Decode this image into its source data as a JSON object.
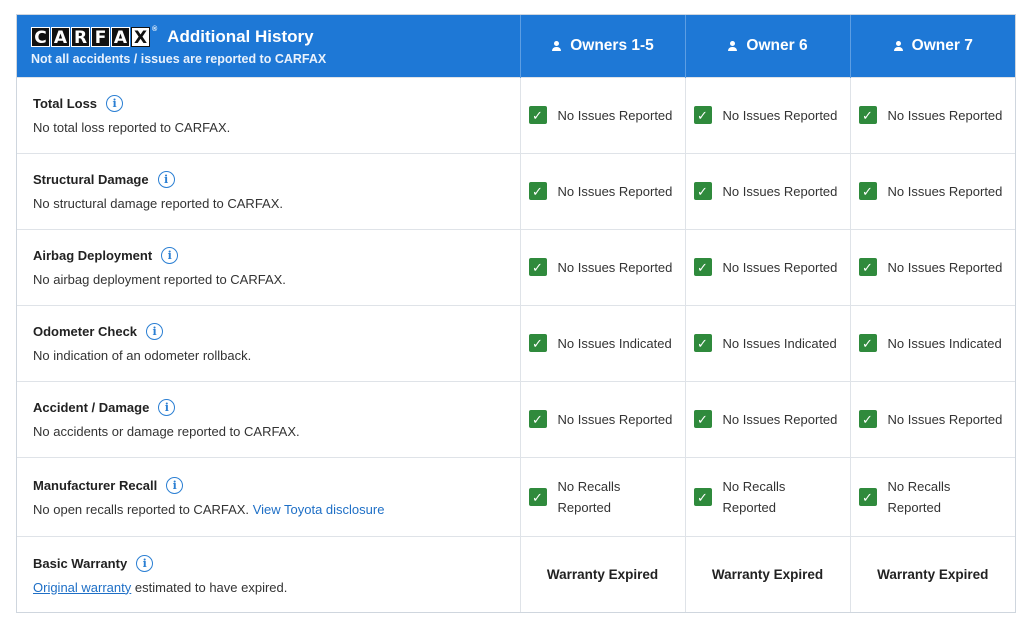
{
  "header": {
    "logo_letters": [
      "C",
      "A",
      "R",
      "F",
      "A",
      "X"
    ],
    "title": "Additional History",
    "subtitle": "Not all accidents / issues are reported to CARFAX",
    "owners": [
      "Owners 1-5",
      "Owner 6",
      "Owner 7"
    ]
  },
  "rows": [
    {
      "title": "Total Loss",
      "desc": "No total loss reported to CARFAX.",
      "status": [
        "No Issues Reported",
        "No Issues Reported",
        "No Issues Reported"
      ]
    },
    {
      "title": "Structural Damage",
      "desc": "No structural damage reported to CARFAX.",
      "status": [
        "No Issues Reported",
        "No Issues Reported",
        "No Issues Reported"
      ]
    },
    {
      "title": "Airbag Deployment",
      "desc": "No airbag deployment reported to CARFAX.",
      "status": [
        "No Issues Reported",
        "No Issues Reported",
        "No Issues Reported"
      ]
    },
    {
      "title": "Odometer Check",
      "desc": "No indication of an odometer rollback.",
      "status": [
        "No Issues Indicated",
        "No Issues Indicated",
        "No Issues Indicated"
      ]
    },
    {
      "title": "Accident / Damage",
      "desc": "No accidents or damage reported to CARFAX.",
      "status": [
        "No Issues Reported",
        "No Issues Reported",
        "No Issues Reported"
      ]
    },
    {
      "title": "Manufacturer Recall",
      "desc": "No open recalls reported to CARFAX.",
      "link": "View Toyota disclosure",
      "status": [
        "No Recalls Reported",
        "No Recalls Reported",
        "No Recalls Reported"
      ]
    },
    {
      "title": "Basic Warranty",
      "desc_link": "Original warranty",
      "desc_rest": "estimated to have expired.",
      "status": [
        "Warranty Expired",
        "Warranty Expired",
        "Warranty Expired"
      ]
    }
  ],
  "colors": {
    "header_bg": "#1e78d6",
    "check_green": "#2f8a3c",
    "link_blue": "#1e6fc6"
  }
}
